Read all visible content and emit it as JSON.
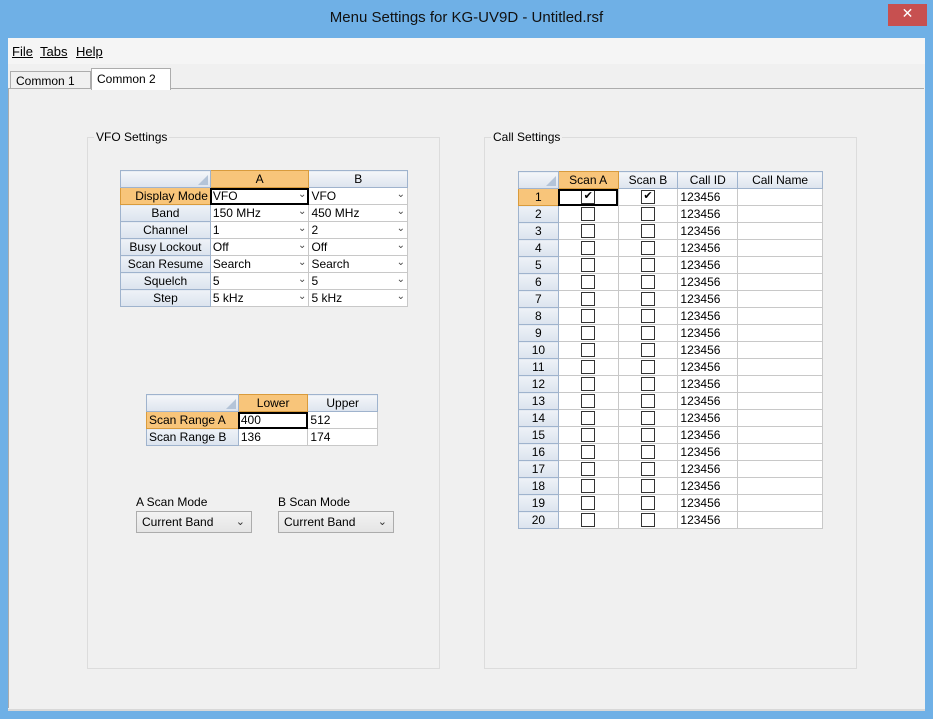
{
  "window": {
    "title": "Menu Settings for KG-UV9D - Untitled.rsf",
    "close_label": "✕"
  },
  "menu": {
    "file": "File",
    "tabs": "Tabs",
    "help": "Help"
  },
  "tabs": [
    {
      "label": "Common 1",
      "active": false
    },
    {
      "label": "Common 2",
      "active": true
    }
  ],
  "vfo": {
    "group_title": "VFO Settings",
    "col_a": "A",
    "col_b": "B",
    "rows": [
      {
        "label": "Display Mode",
        "a": "VFO",
        "b": "VFO"
      },
      {
        "label": "Band",
        "a": "150 MHz",
        "b": "450 MHz"
      },
      {
        "label": "Channel",
        "a": "1",
        "b": "2"
      },
      {
        "label": "Busy Lockout",
        "a": "Off",
        "b": "Off"
      },
      {
        "label": "Scan Resume",
        "a": "Search",
        "b": "Search"
      },
      {
        "label": "Squelch",
        "a": "5",
        "b": "5"
      },
      {
        "label": "Step",
        "a": "5 kHz",
        "b": "5 kHz"
      }
    ]
  },
  "scan_range": {
    "col_lower": "Lower",
    "col_upper": "Upper",
    "rows": [
      {
        "label": "Scan Range A",
        "lower": "400",
        "upper": "512"
      },
      {
        "label": "Scan Range B",
        "lower": "136",
        "upper": "174"
      }
    ]
  },
  "scan_mode": {
    "a_label": "A Scan Mode",
    "a_value": "Current Band",
    "b_label": "B Scan Mode",
    "b_value": "Current Band"
  },
  "call": {
    "group_title": "Call Settings",
    "col_scan_a": "Scan A",
    "col_scan_b": "Scan B",
    "col_call_id": "Call ID",
    "col_call_name": "Call Name",
    "rows": [
      {
        "n": "1",
        "scan_a": true,
        "scan_b": true,
        "id": "123456",
        "name": ""
      },
      {
        "n": "2",
        "scan_a": false,
        "scan_b": false,
        "id": "123456",
        "name": ""
      },
      {
        "n": "3",
        "scan_a": false,
        "scan_b": false,
        "id": "123456",
        "name": ""
      },
      {
        "n": "4",
        "scan_a": false,
        "scan_b": false,
        "id": "123456",
        "name": ""
      },
      {
        "n": "5",
        "scan_a": false,
        "scan_b": false,
        "id": "123456",
        "name": ""
      },
      {
        "n": "6",
        "scan_a": false,
        "scan_b": false,
        "id": "123456",
        "name": ""
      },
      {
        "n": "7",
        "scan_a": false,
        "scan_b": false,
        "id": "123456",
        "name": ""
      },
      {
        "n": "8",
        "scan_a": false,
        "scan_b": false,
        "id": "123456",
        "name": ""
      },
      {
        "n": "9",
        "scan_a": false,
        "scan_b": false,
        "id": "123456",
        "name": ""
      },
      {
        "n": "10",
        "scan_a": false,
        "scan_b": false,
        "id": "123456",
        "name": ""
      },
      {
        "n": "11",
        "scan_a": false,
        "scan_b": false,
        "id": "123456",
        "name": ""
      },
      {
        "n": "12",
        "scan_a": false,
        "scan_b": false,
        "id": "123456",
        "name": ""
      },
      {
        "n": "13",
        "scan_a": false,
        "scan_b": false,
        "id": "123456",
        "name": ""
      },
      {
        "n": "14",
        "scan_a": false,
        "scan_b": false,
        "id": "123456",
        "name": ""
      },
      {
        "n": "15",
        "scan_a": false,
        "scan_b": false,
        "id": "123456",
        "name": ""
      },
      {
        "n": "16",
        "scan_a": false,
        "scan_b": false,
        "id": "123456",
        "name": ""
      },
      {
        "n": "17",
        "scan_a": false,
        "scan_b": false,
        "id": "123456",
        "name": ""
      },
      {
        "n": "18",
        "scan_a": false,
        "scan_b": false,
        "id": "123456",
        "name": ""
      },
      {
        "n": "19",
        "scan_a": false,
        "scan_b": false,
        "id": "123456",
        "name": ""
      },
      {
        "n": "20",
        "scan_a": false,
        "scan_b": false,
        "id": "123456",
        "name": ""
      }
    ]
  },
  "colors": {
    "title_bar": "#6fb0e6",
    "close_button": "#c75050",
    "header_selected": "#f8c57a"
  }
}
